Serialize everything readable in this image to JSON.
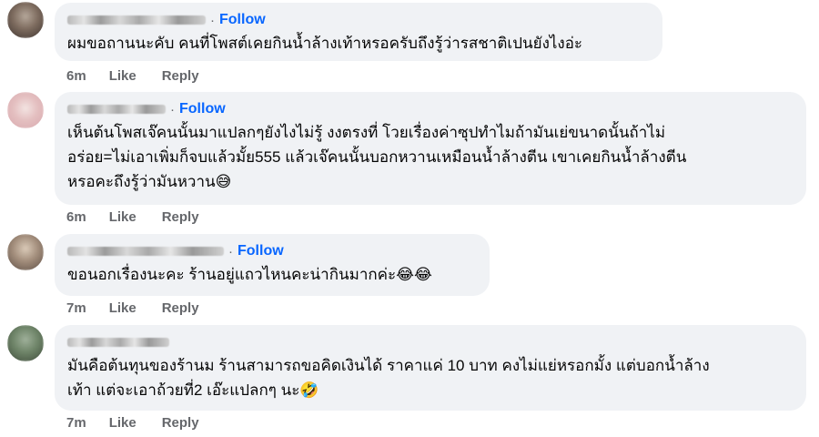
{
  "follow_label": "Follow",
  "like_label": "Like",
  "reply_label": "Reply",
  "comments": [
    {
      "text": "ผมขอถานนะคับ คนที่โพสต์เคยกินน้ำล้างเท้าหรอครับถึงรู้ว่ารสชาติเปนยังไงอ่ะ",
      "emoji": "",
      "time": "6m",
      "follow": true
    },
    {
      "text": "เห็นต้นโพสเจ๊คนนั้นมาแปลกๆยังไงไม่รู้ งงตรงที่ โวยเรื่องค่าซุปทำไมถ้ามันเย่ขนาดนั้นถ้าไม่\nอร่อย=ไม่เอาเพิ่มก็จบแล้วมั้ย555 แล้วเจ๊คนนั้นบอกหวานเหมือนน้ำล้างตีน เขาเคยกินน้ำล้างตีน\nหรอคะถึงรู้ว่ามันหวาน",
      "emoji": "😅",
      "time": "6m",
      "follow": true
    },
    {
      "text": "ขอนอกเรื่องนะคะ ร้านอยู่แถวไหนคะน่ากินมากค่ะ",
      "emoji": "😂😂",
      "time": "7m",
      "follow": true
    },
    {
      "text": "มันคือต้นทุนของร้านม ร้านสามารถขอคิดเงินได้ ราคาแค่ 10 บาท คงไม่แย่หรอกมั้ง แต่บอกน้ำล้าง\nเท้า แต่จะเอาถ้วยที่2 เอ๊ะแปลกๆ นะ",
      "emoji": "🤣",
      "time": "7m",
      "follow": false
    }
  ]
}
